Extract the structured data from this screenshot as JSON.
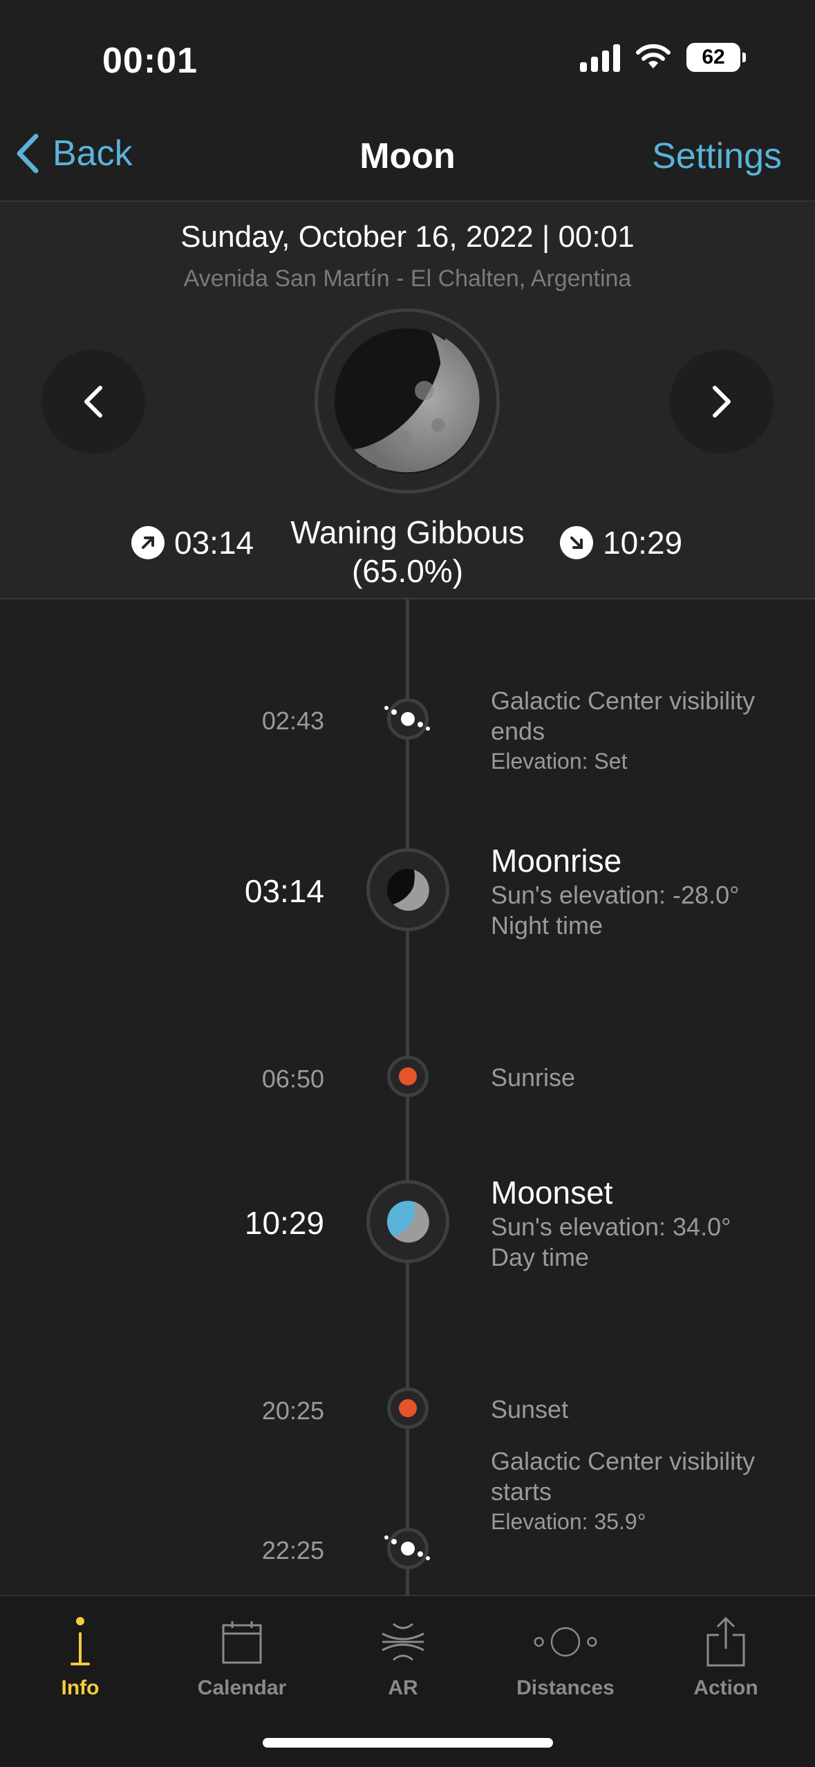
{
  "status": {
    "time": "00:01",
    "battery": "62"
  },
  "nav": {
    "back_label": "Back",
    "title": "Moon",
    "settings_label": "Settings"
  },
  "header": {
    "date": "Sunday, October 16, 2022 | 00:01",
    "location": "Avenida San Martín - El Chalten, Argentina",
    "moonrise_time": "03:14",
    "moonset_time": "10:29",
    "phase_name": "Waning Gibbous",
    "phase_percent": "(65.0%)"
  },
  "timeline": [
    {
      "time": "02:43",
      "title": "Galactic Center visibility ends",
      "sub": "Elevation: Set",
      "icon": "galactic-center-icon"
    },
    {
      "time": "03:14",
      "title": "Moonrise",
      "sub1": "Sun's elevation: -28.0°",
      "sub2": "Night time",
      "icon": "moonrise-icon"
    },
    {
      "time": "06:50",
      "title": "Sunrise",
      "icon": "sunrise-dot-icon"
    },
    {
      "time": "10:29",
      "title": "Moonset",
      "sub1": "Sun's elevation: 34.0°",
      "sub2": "Day time",
      "icon": "moonset-icon"
    },
    {
      "time": "20:25",
      "title": "Sunset",
      "icon": "sunset-dot-icon"
    },
    {
      "time": "22:25",
      "title": "Galactic Center visibility starts",
      "sub": "Elevation: 35.9°",
      "icon": "galactic-center-icon"
    }
  ],
  "tabs": [
    {
      "label": "Info",
      "icon": "info-icon",
      "active": true
    },
    {
      "label": "Calendar",
      "icon": "calendar-icon"
    },
    {
      "label": "AR",
      "icon": "ar-icon"
    },
    {
      "label": "Distances",
      "icon": "distances-icon"
    },
    {
      "label": "Action",
      "icon": "share-icon"
    }
  ],
  "colors": {
    "accent": "#5ab4d9",
    "active_tab": "#f3cd3b",
    "sun_dot": "#e8542a",
    "background": "#1f1f1f"
  }
}
